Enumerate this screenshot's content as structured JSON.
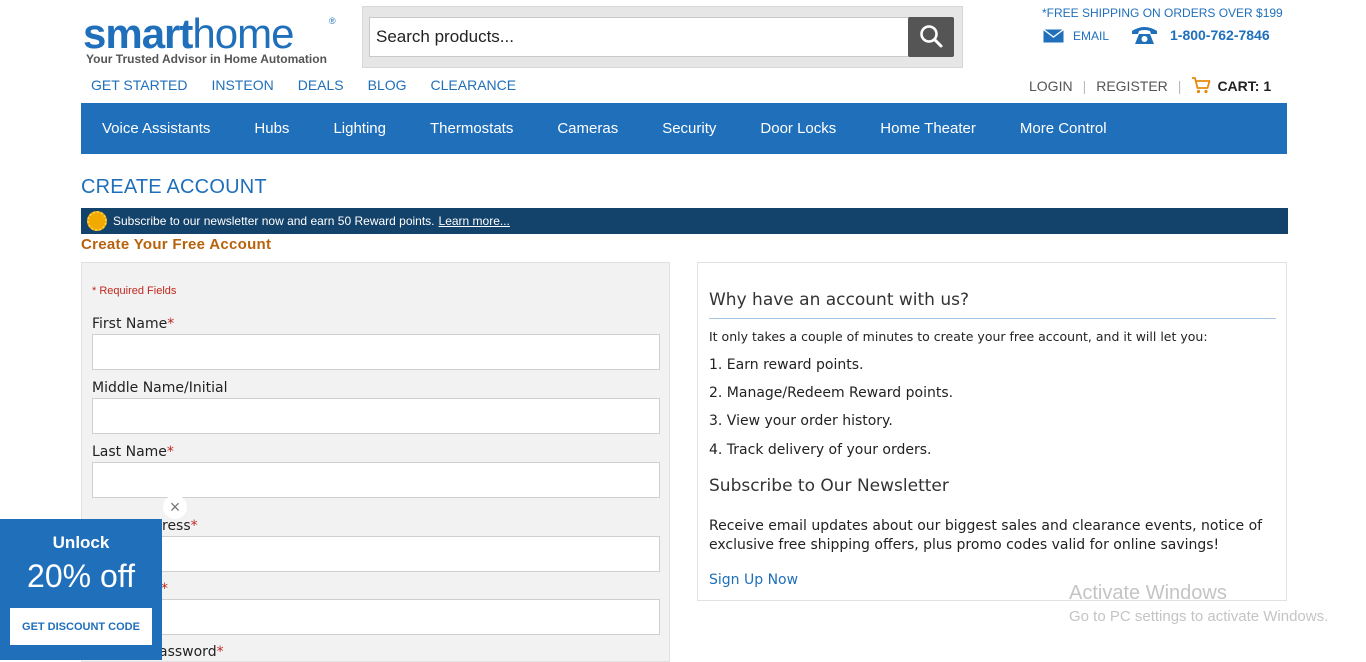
{
  "header": {
    "logo_part1": "smart",
    "logo_part2": "home",
    "logo_reg": "®",
    "tagline": "Your Trusted Advisor in Home Automation",
    "search_placeholder": "Search products...",
    "shipping_note": "*FREE SHIPPING ON ORDERS OVER $199",
    "email_label": "EMAIL",
    "phone": "1-800-762-7846"
  },
  "topnav": [
    "GET STARTED",
    "INSTEON",
    "DEALS",
    "BLOG",
    "CLEARANCE"
  ],
  "account": {
    "login": "LOGIN",
    "register": "REGISTER",
    "cart": "CART: 1",
    "separator": "|"
  },
  "categories": [
    "Voice Assistants",
    "Hubs",
    "Lighting",
    "Thermostats",
    "Cameras",
    "Security",
    "Door Locks",
    "Home Theater",
    "More Control"
  ],
  "page": {
    "title": "CREATE ACCOUNT",
    "promo_text": "Subscribe to our newsletter now and earn 50 Reward points.",
    "promo_link": "Learn more...",
    "subtitle": "Create Your Free Account"
  },
  "form": {
    "required_note": "* Required Fields",
    "star": "*",
    "fields": [
      {
        "label": "First Name",
        "required": true
      },
      {
        "label": "Middle Name/Initial",
        "required": false
      },
      {
        "label": "Last Name",
        "required": true
      },
      {
        "label": "ress",
        "required": true
      },
      {
        "label": "",
        "required": true
      },
      {
        "label": "assword",
        "required": true
      }
    ]
  },
  "info": {
    "heading": "Why have an account with us?",
    "intro": "It only takes a couple of minutes to create your free account, and it will let you:",
    "benefits": [
      "1. Earn reward points.",
      "2. Manage/Redeem Reward points.",
      "3. View your order history.",
      "4. Track delivery of your orders."
    ],
    "newsletter_heading": "Subscribe to Our Newsletter",
    "newsletter_text": "Receive email updates about our biggest sales and clearance events, notice of exclusive free shipping offers, plus promo codes valid for online savings!",
    "signup_link": "Sign Up Now"
  },
  "popup": {
    "unlock": "Unlock",
    "discount": "20% off",
    "button": "GET DISCOUNT CODE",
    "close": "×"
  },
  "watermark": {
    "line1": "Activate Windows",
    "line2": "Go to PC settings to activate Windows."
  },
  "colors": {
    "brand_blue": "#1f6fbb",
    "promo_bar": "#13426b",
    "orange_heading": "#b8620c",
    "required_red": "#c0271e"
  }
}
